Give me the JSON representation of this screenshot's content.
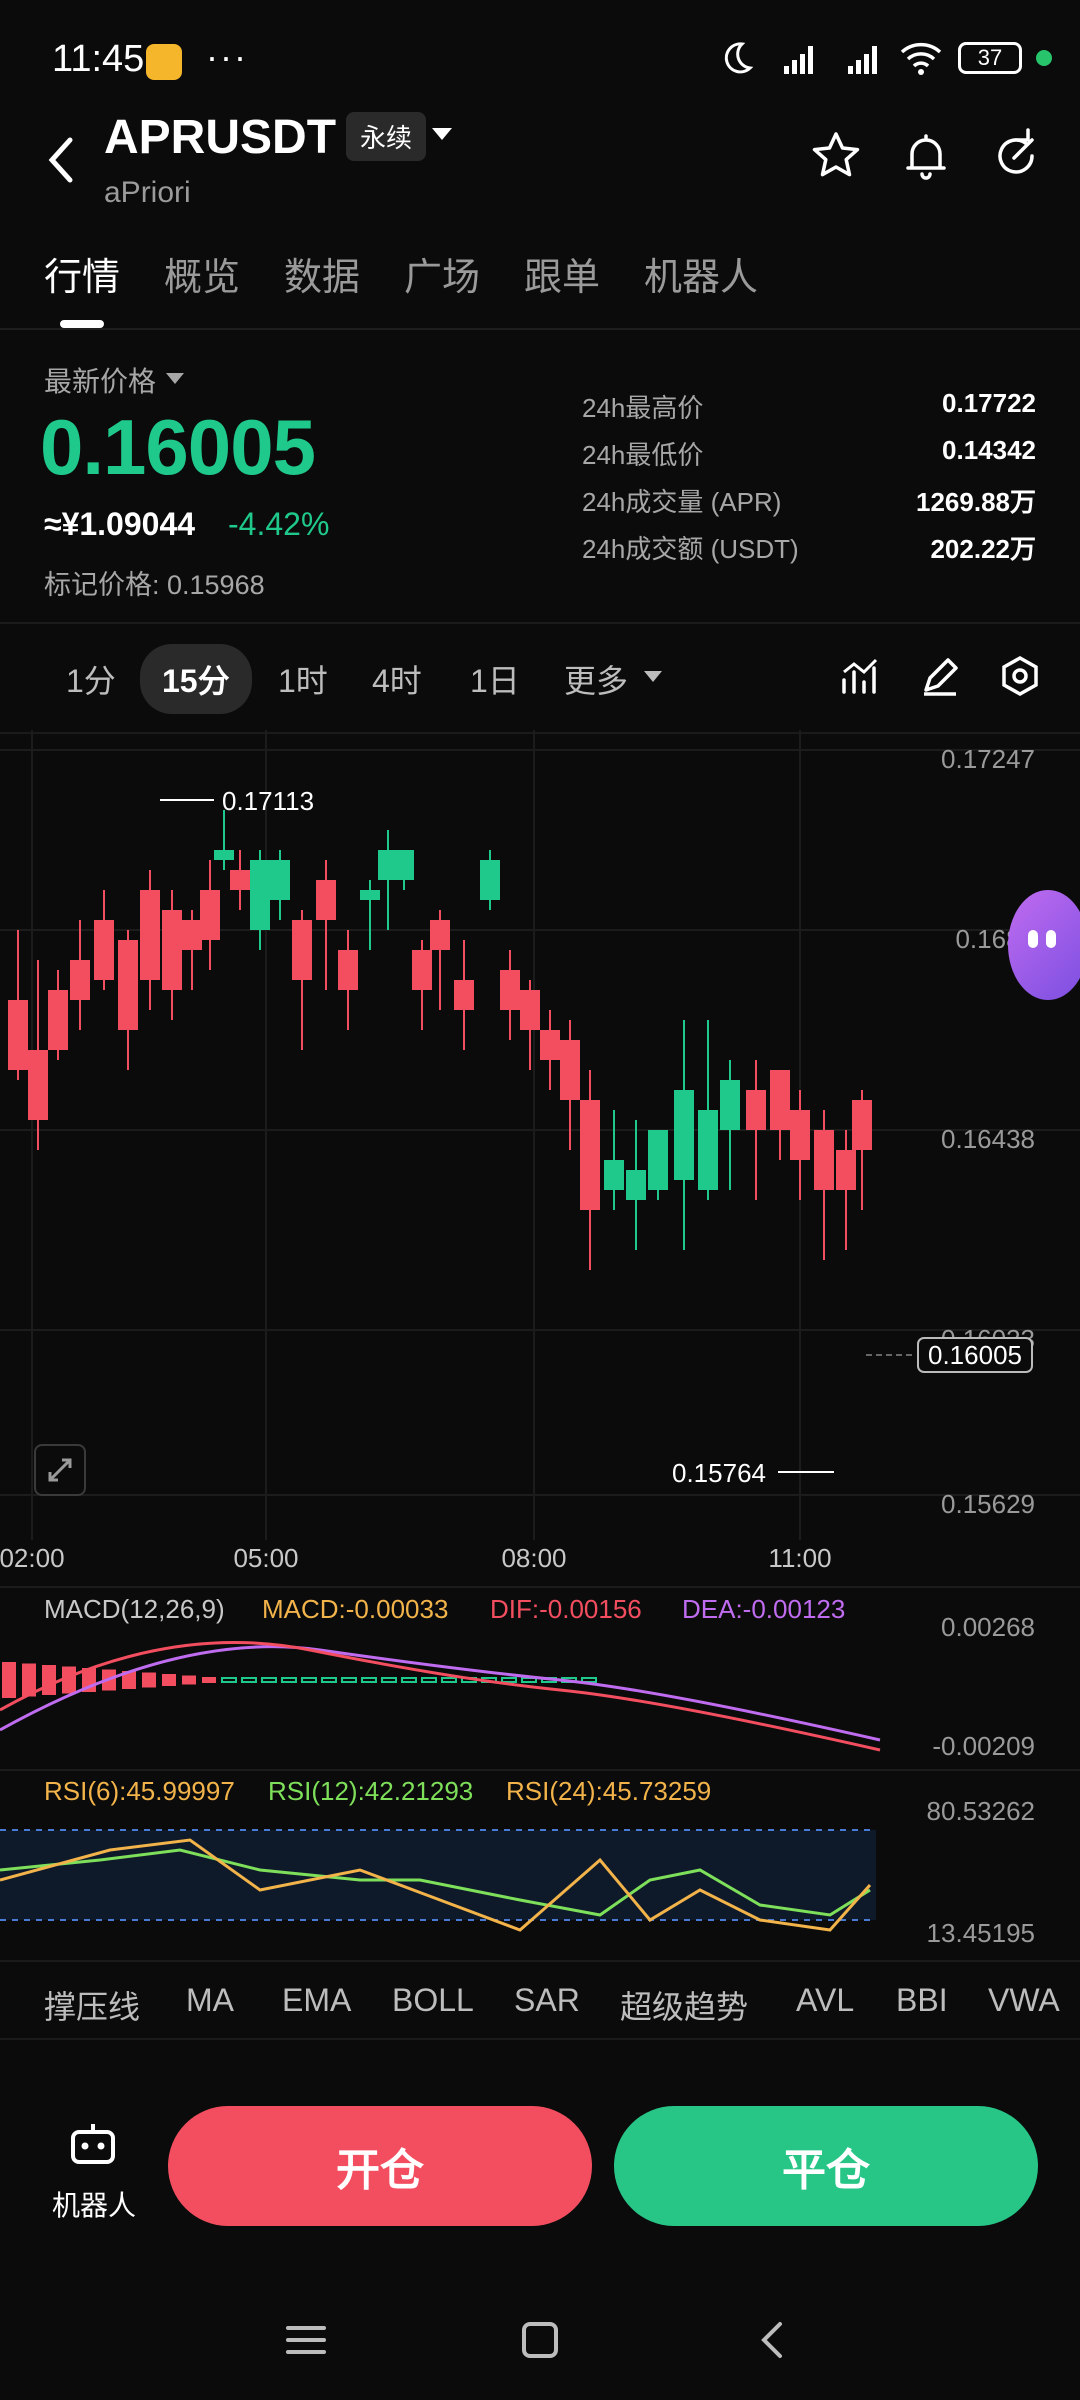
{
  "status_bar": {
    "time": "11:45",
    "dots": "···",
    "battery": "37"
  },
  "header": {
    "pair": "APRUSDT",
    "contract_type": "永续",
    "name": "aPriori"
  },
  "tabs": [
    "行情",
    "概览",
    "数据",
    "广场",
    "跟单",
    "机器人"
  ],
  "price": {
    "label": "最新价格",
    "last": "0.16005",
    "cny": "≈¥1.09044",
    "change": "-4.42%",
    "mark": "标记价格: 0.15968"
  },
  "stats": [
    {
      "label": "24h最高价",
      "value": "0.17722"
    },
    {
      "label": "24h最低价",
      "value": "0.14342"
    },
    {
      "label": "24h成交量 (APR)",
      "value": "1269.88万"
    },
    {
      "label": "24h成交额 (USDT)",
      "value": "202.22万"
    }
  ],
  "timeframes": [
    "1分",
    "15分",
    "1时",
    "4时",
    "1日",
    "更多"
  ],
  "active_timeframe": "15分",
  "chart_data": {
    "type": "candlestick",
    "y_axis": [
      "0.17247",
      "0.1684",
      "0.16438",
      "0.16033",
      "0.15629"
    ],
    "ylim": [
      0.15629,
      0.17247
    ],
    "x_axis": [
      "02:00",
      "05:00",
      "08:00",
      "11:00"
    ],
    "high_marker": "0.17113",
    "low_marker": "0.15764",
    "last_price_tag": "0.16005",
    "colors": {
      "up": "#1fc98b",
      "down": "#f24e5f"
    }
  },
  "macd": {
    "label": "MACD(12,26,9)",
    "macd": "MACD:-0.00033",
    "dif": "DIF:-0.00156",
    "dea": "DEA:-0.00123",
    "ymax": "0.00268",
    "ymin": "-0.00209"
  },
  "rsi": {
    "rsi6": "RSI(6):45.99997",
    "rsi12": "RSI(12):42.21293",
    "rsi24": "RSI(24):45.73259",
    "ymax": "80.53262",
    "ymin": "13.45195"
  },
  "indicators": [
    "撑压线",
    "MA",
    "EMA",
    "BOLL",
    "SAR",
    "超级趋势",
    "AVL",
    "BBI",
    "VWA"
  ],
  "bottom": {
    "robot_label": "机器人",
    "open": "开仓",
    "close": "平仓"
  }
}
